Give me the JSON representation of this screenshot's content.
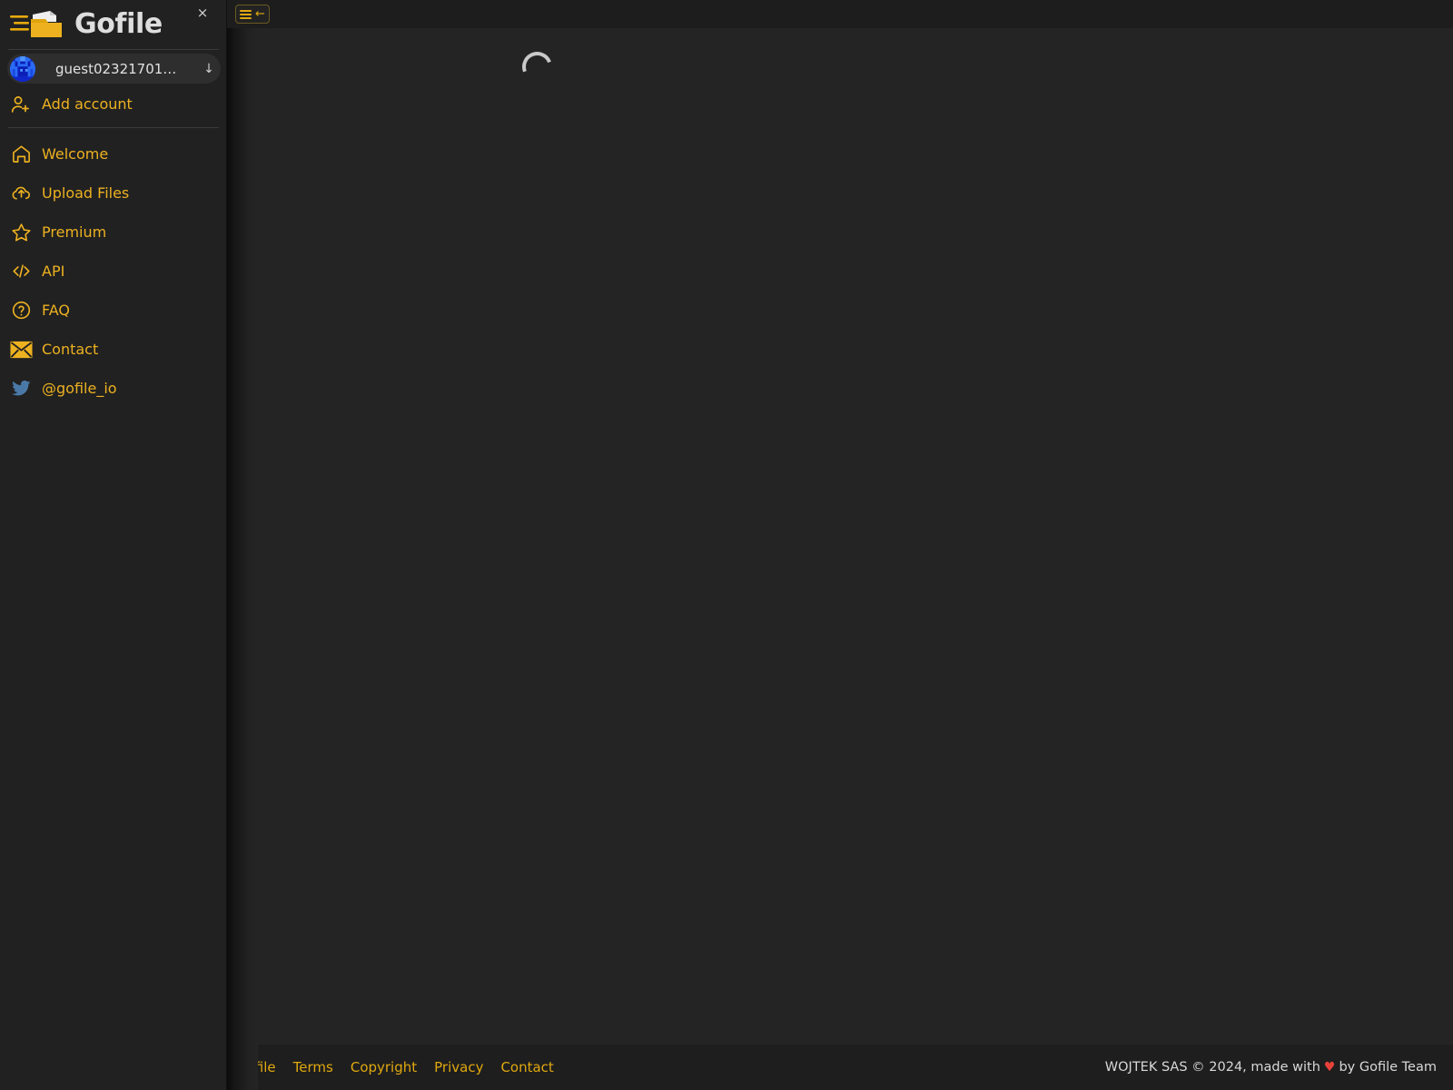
{
  "app": {
    "brand_title": "Gofile",
    "logo_icon": "folder-speed-logo",
    "close_icon": "close-icon",
    "close_label": "×"
  },
  "sidebar": {
    "account": {
      "avatar_icon": "identicon-avatar",
      "name": "guest02321701…",
      "caret_icon": "arrow-down-icon",
      "caret_glyph": "↓"
    },
    "add_account": {
      "label": "Add account",
      "icon": "user-plus-icon"
    },
    "items": [
      {
        "label": "Welcome",
        "icon": "home-icon"
      },
      {
        "label": "Upload Files",
        "icon": "cloud-upload-icon"
      },
      {
        "label": "Premium",
        "icon": "star-icon"
      },
      {
        "label": "API",
        "icon": "code-brackets-icon"
      },
      {
        "label": "FAQ",
        "icon": "question-circle-icon"
      },
      {
        "label": "Contact",
        "icon": "envelope-icon"
      },
      {
        "label": "@gofile_io",
        "icon": "twitter-bird-icon"
      }
    ]
  },
  "topbar": {
    "menu_button_label": "",
    "menu_icon": "hamburger-icon",
    "back_icon": "arrow-left-icon",
    "back_glyph": "←"
  },
  "content": {
    "status": "loading",
    "spinner_icon": "loading-spinner-icon"
  },
  "footer": {
    "links": [
      {
        "label": "Gofile"
      },
      {
        "label": "Terms"
      },
      {
        "label": "Copyright"
      },
      {
        "label": "Privacy"
      },
      {
        "label": "Contact"
      }
    ],
    "copyright_prefix": "WOJTEK SAS © 2024, made with",
    "heart_glyph": "♥",
    "copyright_suffix": "by Gofile Team"
  },
  "colors": {
    "accent": "#edb120",
    "sidebar_bg": "#212121",
    "main_bg": "#242424",
    "topbar_bg": "#1d1d1d",
    "footer_bg": "#1e1e1e",
    "text_light": "#dedede",
    "twitter_blue": "#4a79a8",
    "heart_red": "#e8413a"
  }
}
